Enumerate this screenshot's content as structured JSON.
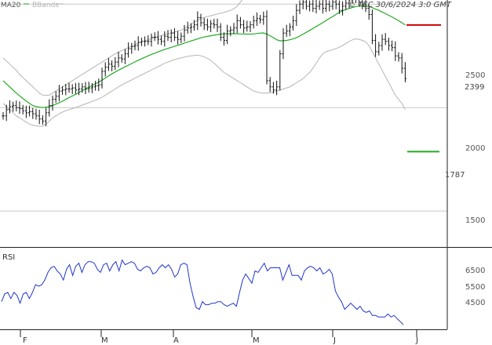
{
  "header": {
    "legend_ma": "MA20",
    "legend_bb": "BBands",
    "copyright": "© TEC 30/6/2024 3:0 GMT"
  },
  "colors": {
    "ma": "#22aa22",
    "bbands": "#b4b4b4",
    "price": "#111111",
    "rsi": "#1f36c9",
    "resistance": "#cc0000",
    "support": "#22aa22",
    "grid": "#c8c8c8",
    "frame": "#222222"
  },
  "chart_data": [
    {
      "type": "ohlc",
      "title": "",
      "x_tick_labels": [
        "F",
        "M",
        "A",
        "M",
        "J",
        "J"
      ],
      "y_tick_labels": [
        "2500",
        "2000",
        "1500"
      ],
      "y_ticks": [
        2500,
        2000,
        1500
      ],
      "ylim": [
        1330,
        2520
      ],
      "legend": [
        "MA20",
        "BBands"
      ],
      "grid": true,
      "levels": [
        {
          "label": "2399",
          "value": 2399,
          "kind": "resistance"
        },
        {
          "label": "1787",
          "value": 1787,
          "kind": "support"
        }
      ],
      "close": [
        1960,
        1990,
        2005,
        2010,
        2000,
        1995,
        1985,
        1975,
        1980,
        1970,
        1960,
        1945,
        1935,
        1975,
        2010,
        2040,
        2055,
        2080,
        2085,
        2090,
        2090,
        2095,
        2085,
        2090,
        2100,
        2090,
        2095,
        2100,
        2105,
        2110,
        2175,
        2195,
        2210,
        2200,
        2220,
        2240,
        2235,
        2260,
        2285,
        2295,
        2300,
        2315,
        2320,
        2320,
        2320,
        2340,
        2340,
        2330,
        2320,
        2345,
        2340,
        2360,
        2340,
        2330,
        2345,
        2375,
        2385,
        2390,
        2400,
        2435,
        2410,
        2400,
        2390,
        2405,
        2400,
        2390,
        2340,
        2325,
        2370,
        2375,
        2385,
        2420,
        2400,
        2385,
        2390,
        2400,
        2420,
        2430,
        2425,
        2440,
        2130,
        2100,
        2085,
        2100,
        2260,
        2360,
        2370,
        2390,
        2420,
        2470,
        2500,
        2510,
        2490,
        2500,
        2480,
        2490,
        2500,
        2480,
        2500,
        2490,
        2510,
        2500,
        2470,
        2490,
        2505,
        2520,
        2530,
        2545,
        2510,
        2500,
        2480,
        2450,
        2325,
        2270,
        2300,
        2330,
        2320,
        2300,
        2290,
        2250,
        2240,
        2190,
        2140
      ],
      "ma20": [
        2130,
        2115,
        2100,
        2085,
        2070,
        2057,
        2044,
        2032,
        2020,
        2010,
        2005,
        2002,
        2000,
        2002,
        2005,
        2010,
        2016,
        2023,
        2031,
        2040,
        2048,
        2056,
        2064,
        2073,
        2082,
        2091,
        2099,
        2107,
        2115,
        2123,
        2133,
        2143,
        2153,
        2163,
        2172,
        2181,
        2189,
        2197,
        2205,
        2213,
        2221,
        2229,
        2236,
        2243,
        2250,
        2257,
        2263,
        2269,
        2275,
        2281,
        2286,
        2291,
        2296,
        2301,
        2306,
        2312,
        2317,
        2322,
        2327,
        2332,
        2337,
        2341,
        2344,
        2347,
        2350,
        2353,
        2355,
        2356,
        2357,
        2357,
        2357,
        2357,
        2356,
        2356,
        2355,
        2355,
        2356,
        2358,
        2360,
        2361,
        2355,
        2347,
        2338,
        2328,
        2323,
        2323,
        2325,
        2328,
        2332,
        2338,
        2346,
        2355,
        2364,
        2373,
        2382,
        2392,
        2401,
        2411,
        2421,
        2431,
        2440,
        2450,
        2460,
        2468,
        2474,
        2479,
        2484,
        2488,
        2491,
        2492,
        2492,
        2489,
        2483,
        2476,
        2470,
        2462,
        2454,
        2446,
        2438,
        2429,
        2420,
        2410,
        2400
      ],
      "bb_upper": [
        2240,
        2225,
        2210,
        2195,
        2180,
        2160,
        2145,
        2130,
        2115,
        2100,
        2085,
        2070,
        2060,
        2060,
        2060,
        2070,
        2080,
        2090,
        2100,
        2110,
        2120,
        2130,
        2140,
        2150,
        2160,
        2170,
        2180,
        2190,
        2200,
        2210,
        2220,
        2230,
        2240,
        2250,
        2260,
        2268,
        2275,
        2282,
        2290,
        2297,
        2305,
        2312,
        2318,
        2323,
        2328,
        2333,
        2338,
        2343,
        2348,
        2353,
        2357,
        2361,
        2365,
        2370,
        2375,
        2382,
        2392,
        2402,
        2412,
        2422,
        2430,
        2436,
        2440,
        2444,
        2448,
        2452,
        2456,
        2460,
        2465,
        2470,
        2478,
        2490,
        2510,
        2530,
        2550,
        2570,
        2590,
        2610,
        2630,
        2645,
        2655,
        2662,
        2668,
        2672,
        2675,
        2675,
        2673,
        2670,
        2665,
        2660,
        2650,
        2640,
        2620,
        2595,
        2570,
        2550,
        2545,
        2555,
        2570,
        2585,
        2600,
        2615,
        2628,
        2640,
        2648,
        2655,
        2660,
        2665,
        2668,
        2670,
        2672,
        2672,
        2672,
        2672,
        2672,
        2672,
        2672,
        2672,
        2672,
        2672,
        2670,
        2668,
        2665
      ],
      "bb_lower": [
        2020,
        2005,
        1990,
        1975,
        1960,
        1950,
        1940,
        1930,
        1920,
        1915,
        1912,
        1910,
        1910,
        1920,
        1935,
        1950,
        1960,
        1970,
        1978,
        1985,
        1990,
        1995,
        2000,
        2006,
        2012,
        2018,
        2024,
        2030,
        2036,
        2042,
        2050,
        2060,
        2070,
        2080,
        2090,
        2100,
        2110,
        2118,
        2126,
        2134,
        2142,
        2150,
        2158,
        2166,
        2174,
        2182,
        2190,
        2198,
        2206,
        2214,
        2220,
        2226,
        2232,
        2236,
        2240,
        2244,
        2248,
        2250,
        2252,
        2254,
        2250,
        2245,
        2238,
        2228,
        2215,
        2200,
        2185,
        2170,
        2160,
        2150,
        2140,
        2130,
        2120,
        2110,
        2100,
        2090,
        2080,
        2075,
        2072,
        2070,
        2070,
        2072,
        2075,
        2080,
        2085,
        2090,
        2095,
        2100,
        2110,
        2120,
        2130,
        2140,
        2155,
        2170,
        2190,
        2215,
        2240,
        2260,
        2270,
        2275,
        2280,
        2285,
        2292,
        2300,
        2310,
        2320,
        2328,
        2332,
        2330,
        2325,
        2318,
        2300,
        2270,
        2240,
        2210,
        2180,
        2150,
        2120,
        2090,
        2060,
        2040,
        2020,
        1990
      ],
      "rsi": [
        42,
        47,
        48,
        44,
        48,
        46,
        41,
        47,
        48,
        44,
        48,
        53,
        52,
        53,
        56,
        61,
        64,
        65,
        62,
        60,
        56,
        63,
        66,
        59,
        65,
        67,
        61,
        66,
        68,
        68,
        67,
        63,
        61,
        66,
        67,
        62,
        66,
        68,
        62,
        69,
        66,
        67,
        68,
        67,
        63,
        62,
        64,
        65,
        64,
        60,
        61,
        64,
        66,
        64,
        66,
        63,
        58,
        60,
        66,
        67,
        66,
        54,
        45,
        38,
        37,
        42,
        40,
        40,
        41,
        41,
        42,
        42,
        40,
        39,
        40,
        41,
        39,
        48,
        56,
        60,
        57,
        54,
        62,
        61,
        64,
        67,
        62,
        64,
        64,
        64,
        64,
        56,
        61,
        66,
        59,
        59,
        59,
        56,
        62,
        64,
        65,
        64,
        62,
        64,
        60,
        61,
        63,
        60,
        49,
        45,
        42,
        37,
        39,
        41,
        39,
        37,
        39,
        36,
        35,
        36,
        33,
        33,
        32,
        32,
        32,
        34,
        32,
        33,
        31,
        29,
        27
      ]
    },
    {
      "type": "line",
      "title": "RSI",
      "y_tick_labels": [
        "6500",
        "5500",
        "4500"
      ],
      "ylim": [
        24,
        76
      ]
    }
  ]
}
